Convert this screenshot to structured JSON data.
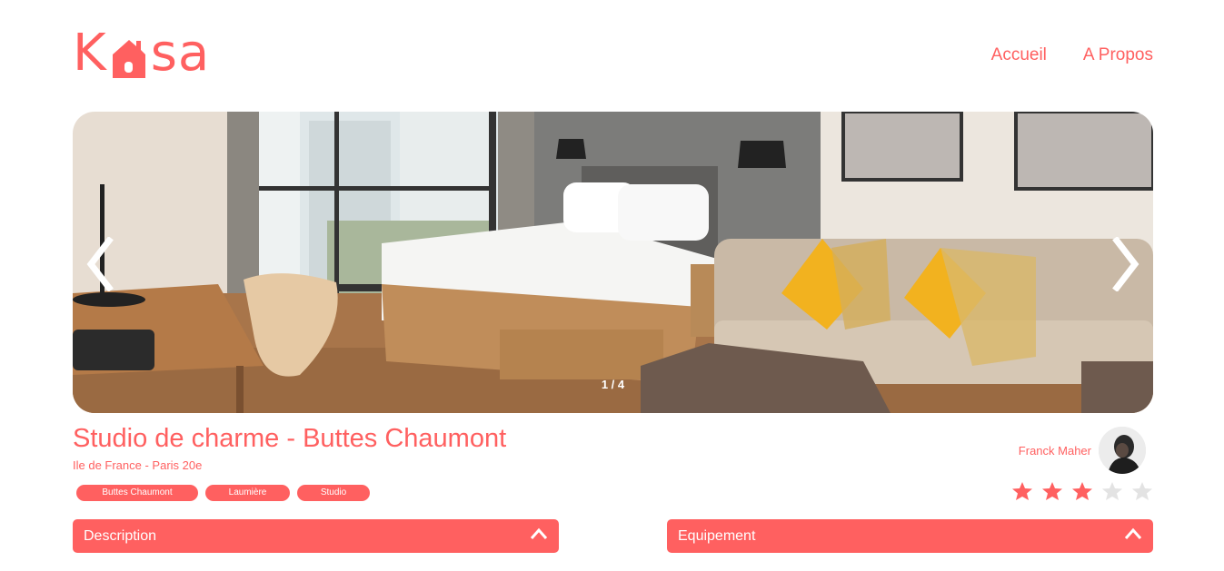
{
  "logo": {
    "text_before": "K",
    "text_after": "sa"
  },
  "nav": {
    "home": "Accueil",
    "about": "A Propos"
  },
  "carousel": {
    "counter": "1 / 4"
  },
  "listing": {
    "title": "Studio de charme - Buttes Chaumont",
    "location": "Ile de France - Paris 20e",
    "tags": [
      "Buttes Chaumont",
      "Laumière",
      "Studio"
    ]
  },
  "host": {
    "name": "Franck Maher"
  },
  "rating": {
    "value": 3,
    "max": 5
  },
  "collapses": {
    "description": "Description",
    "equipment": "Equipement"
  },
  "colors": {
    "accent": "#FF6060",
    "star_empty": "#E3E3E3"
  },
  "icons": {
    "prev": "chevron-left-icon",
    "next": "chevron-right-icon",
    "toggle": "chevron-up-icon",
    "star": "star-icon"
  }
}
